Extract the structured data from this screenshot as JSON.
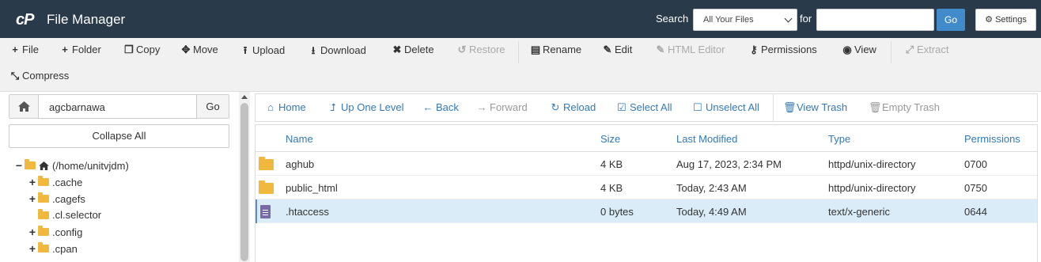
{
  "header": {
    "logo": "cP",
    "title": "File Manager",
    "search_label": "Search",
    "search_scope": "All Your Files",
    "for_label": "for",
    "search_value": "",
    "go_label": "Go",
    "settings_label": "Settings"
  },
  "toolbar": {
    "file": "File",
    "folder": "Folder",
    "copy": "Copy",
    "move": "Move",
    "upload": "Upload",
    "download": "Download",
    "delete": "Delete",
    "restore": "Restore",
    "rename": "Rename",
    "edit": "Edit",
    "html_editor": "HTML Editor",
    "permissions": "Permissions",
    "view": "View",
    "extract": "Extract",
    "compress": "Compress"
  },
  "sidebar": {
    "path": "agcbarnawa",
    "go_label": "Go",
    "collapse_label": "Collapse All",
    "tree": [
      {
        "label": "(/home/unitvjdm)",
        "toggle": "−"
      },
      {
        "label": ".cache",
        "toggle": "+"
      },
      {
        "label": ".cagefs",
        "toggle": "+"
      },
      {
        "label": ".cl.selector",
        "toggle": ""
      },
      {
        "label": ".config",
        "toggle": "+"
      },
      {
        "label": ".cpan",
        "toggle": "+"
      }
    ]
  },
  "nav": {
    "home": "Home",
    "up_one_level": "Up One Level",
    "back": "Back",
    "forward": "Forward",
    "reload": "Reload",
    "select_all": "Select All",
    "unselect_all": "Unselect All",
    "view_trash": "View Trash",
    "empty_trash": "Empty Trash"
  },
  "table": {
    "headers": {
      "name": "Name",
      "size": "Size",
      "last_modified": "Last Modified",
      "type": "Type",
      "permissions": "Permissions"
    },
    "rows": [
      {
        "name": "aghub",
        "size": "4 KB",
        "modified": "Aug 17, 2023, 2:34 PM",
        "type": "httpd/unix-directory",
        "perms": "0700"
      },
      {
        "name": "public_html",
        "size": "4 KB",
        "modified": "Today, 2:43 AM",
        "type": "httpd/unix-directory",
        "perms": "0750"
      },
      {
        "name": ".htaccess",
        "size": "0 bytes",
        "modified": "Today, 4:49 AM",
        "type": "text/x-generic",
        "perms": "0644"
      }
    ]
  },
  "colors": {
    "header_bg": "#293a4a",
    "accent": "#428bca",
    "link": "#337ab7",
    "folder": "#f0b93e",
    "selected_row": "#d9ecf7"
  }
}
